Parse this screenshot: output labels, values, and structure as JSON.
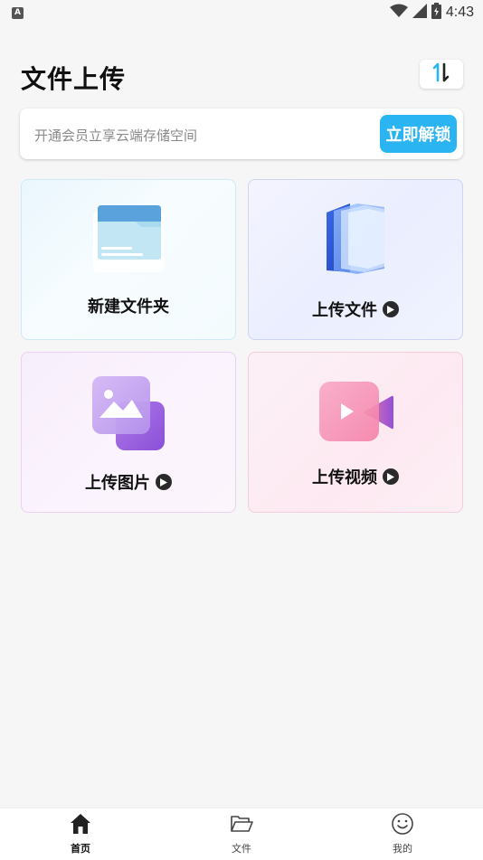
{
  "status_bar": {
    "time": "4:43",
    "badge": "A"
  },
  "header": {
    "title": "文件上传"
  },
  "promo": {
    "text": "开通会员立享云端存储空间",
    "button_label": "立即解锁"
  },
  "cards": [
    {
      "label": "新建文件夹"
    },
    {
      "label": "上传文件"
    },
    {
      "label": "上传图片"
    },
    {
      "label": "上传视频"
    }
  ],
  "bottom_nav": [
    {
      "label": "首页",
      "active": true
    },
    {
      "label": "文件",
      "active": false
    },
    {
      "label": "我的",
      "active": false
    }
  ],
  "colors": {
    "accent": "#2bb4f2"
  }
}
